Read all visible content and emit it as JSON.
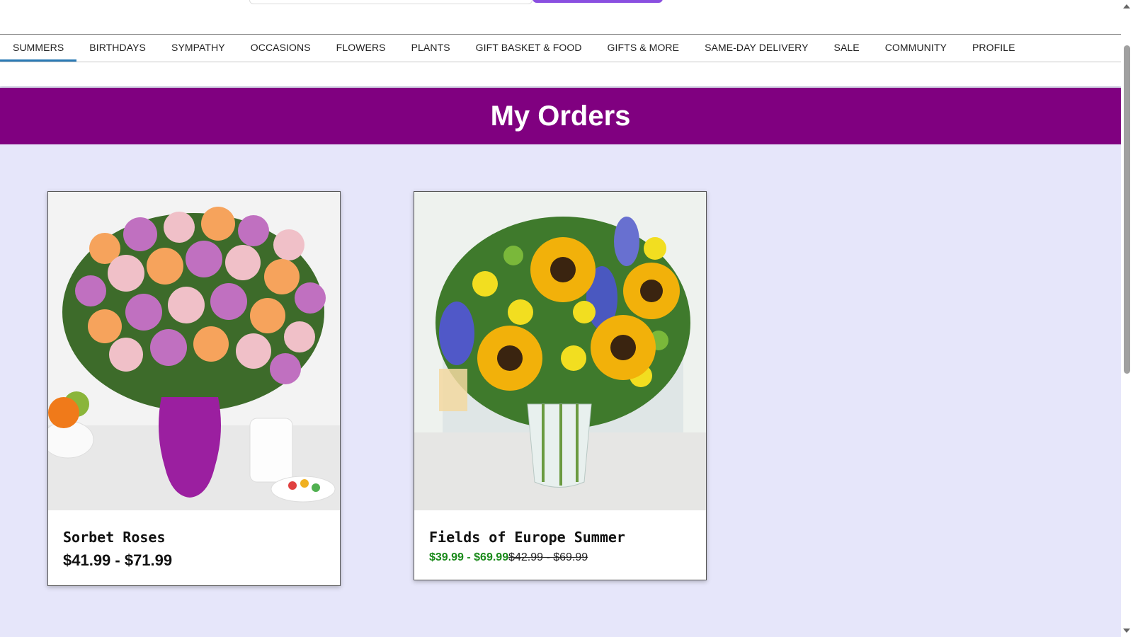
{
  "colors": {
    "page_background": "#e6e6fa",
    "banner": "#800080",
    "active_tab_underline": "#2a7ab5",
    "search_button": "#8a4fe0",
    "sale_price": "#1a8a1a"
  },
  "nav": {
    "items": [
      {
        "label": "SUMMERS",
        "active": true
      },
      {
        "label": "BIRTHDAYS"
      },
      {
        "label": "SYMPATHY"
      },
      {
        "label": "OCCASIONS"
      },
      {
        "label": "FLOWERS"
      },
      {
        "label": "PLANTS"
      },
      {
        "label": "GIFT BASKET & FOOD"
      },
      {
        "label": "GIFTS & MORE"
      },
      {
        "label": "SAME-DAY DELIVERY"
      },
      {
        "label": "SALE"
      },
      {
        "label": "COMMUNITY"
      },
      {
        "label": "PROFILE"
      }
    ]
  },
  "page": {
    "title": "My Orders"
  },
  "orders": [
    {
      "name": "Sorbet Roses",
      "price": "$41.99 - $71.99",
      "image": "roses-bouquet-image"
    },
    {
      "name": "Fields of Europe Summer",
      "sale_price": "$39.99 - $69.99",
      "original_price": "$42.99 - $69.99",
      "image": "sunflower-bouquet-image"
    }
  ]
}
